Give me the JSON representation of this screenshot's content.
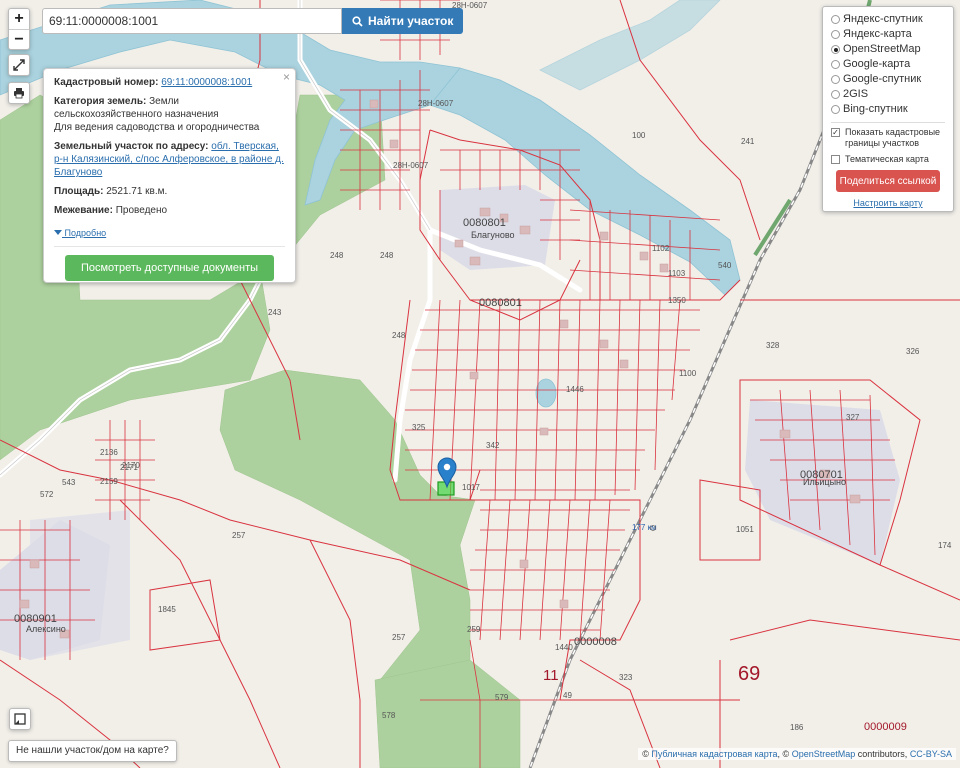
{
  "search": {
    "value": "69:11:0000008:1001",
    "button_label": "Найти участок"
  },
  "zoom": {
    "in": "+",
    "out": "−"
  },
  "info_popup": {
    "close": "×",
    "cadastral_label": "Кадастровый номер:",
    "cadastral_value": "69:11:0000008:1001",
    "category_label": "Категория земель:",
    "category_value": "Земли сельскохозяйственного назначения",
    "usage_value": "Для ведения садоводства и огородничества",
    "address_label": "Земельный участок по адресу:",
    "address_value": "обл. Тверская, р-н Калязинский, с/пос Алферовское, в районе д. Благуново",
    "area_label": "Площадь:",
    "area_value": "2521.71 кв.м.",
    "survey_label": "Межевание:",
    "survey_value": "Проведено",
    "more_link": "Подробно",
    "docs_button": "Посмотреть доступные документы"
  },
  "layers": {
    "options": [
      {
        "label": "Яндекс-спутник",
        "selected": false
      },
      {
        "label": "Яндекс-карта",
        "selected": false
      },
      {
        "label": "OpenStreetMap",
        "selected": true
      },
      {
        "label": "Google-карта",
        "selected": false
      },
      {
        "label": "Google-спутник",
        "selected": false
      },
      {
        "label": "2GIS",
        "selected": false
      },
      {
        "label": "Bing-спутник",
        "selected": false
      }
    ],
    "show_cadastral": {
      "label": "Показать кадастровые границы участков",
      "checked": true
    },
    "thematic": {
      "label": "Тематическая карта",
      "checked": false
    },
    "share_button": "Поделиться ссылкой",
    "setup_link": "Настроить карту"
  },
  "not_found_button": "Не нашли участок/дом на карте?",
  "attribution": {
    "prefix": "©",
    "pkk": "Публичная кадастровая карта",
    "osm_prefix": ", ©",
    "osm": "OpenStreetMap",
    "contributors": "contributors,",
    "license": "CC-BY-SA"
  },
  "map_labels": {
    "road_top": "28Н-0607",
    "road_mid": "28Н-0607",
    "road_lower": "28Н-0607",
    "block_blagunovo": "0080801",
    "block_blagunovo_2": "0080801",
    "place_blagunovo": "Благуново",
    "block_ilyintsyno": "0080701",
    "place_ilyintsyno": "Ильицыно",
    "block_alekseevo": "0080901",
    "place_alekseevo": "Алексино",
    "quarter_0000008": "0000008",
    "quarter_0000009": "0000009",
    "district_69": "69",
    "district_11": "11",
    "km_marker": "177 км",
    "parcels": [
      "248",
      "248",
      "248",
      "257",
      "257",
      "259",
      "579",
      "578",
      "1845",
      "1051",
      "100",
      "241",
      "326",
      "327",
      "328",
      "174",
      "186",
      "323",
      "49",
      "1102",
      "1103",
      "1350",
      "1100",
      "2136",
      "2171",
      "2170",
      "2159",
      "572",
      "543",
      "1446",
      "342",
      "325",
      "540",
      "1440",
      "1017",
      "243"
    ]
  },
  "colors": {
    "water": "#aad3df",
    "forest": "#add19e",
    "land": "#f2efe9",
    "built": "#dddde8",
    "cadastral": "#d9333f",
    "marker": "#2a81cb",
    "selected_parcel": "#3fd13f"
  },
  "icons": {
    "search": "search-icon",
    "fullscreen": "fullscreen-icon",
    "print": "print-icon",
    "marker": "location-marker-icon",
    "corner": "frame-icon",
    "chevron": "chevron-down-icon"
  }
}
